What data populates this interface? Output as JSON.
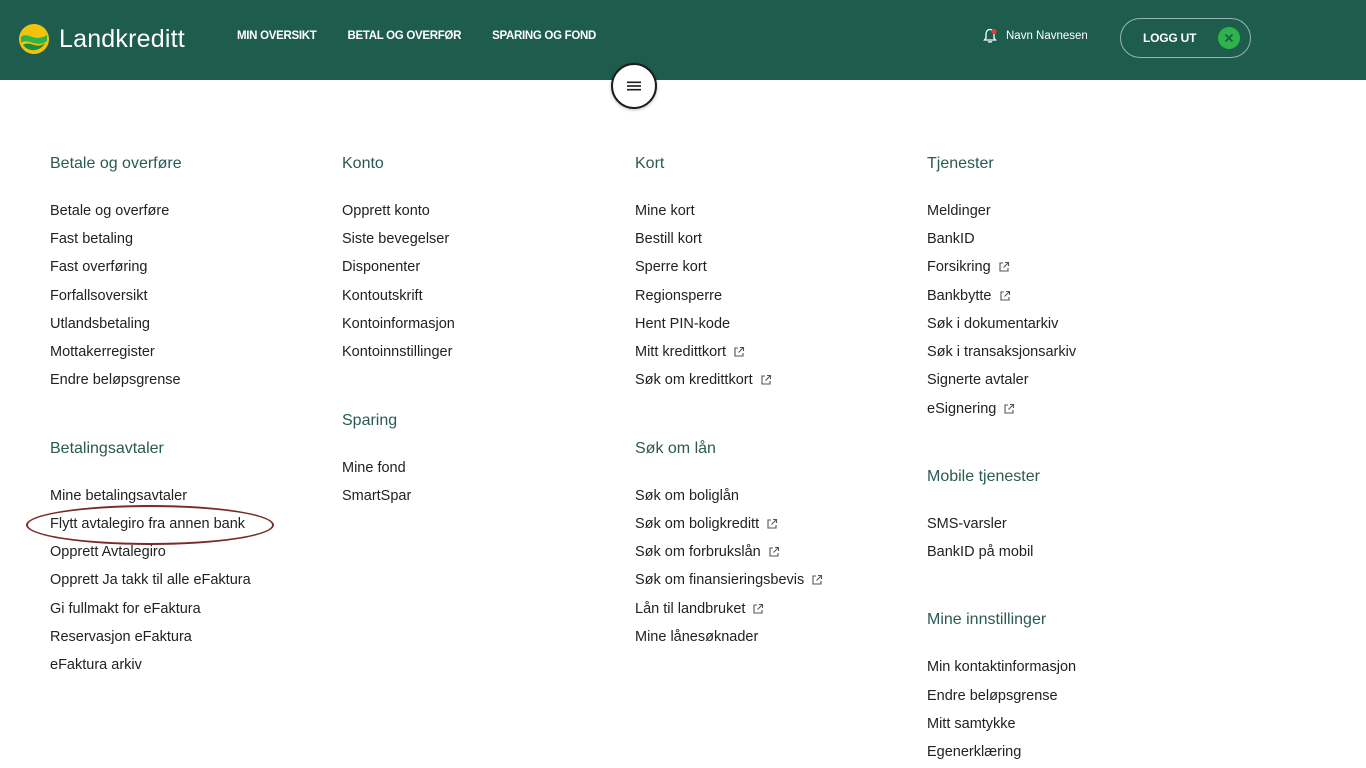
{
  "brand": {
    "name": "Landkreditt"
  },
  "colors": {
    "header_bg": "#1e5c4e",
    "heading": "#2a5a52",
    "accent": "#2fb34a",
    "highlight": "#7a2a2a"
  },
  "nav": [
    "MIN OVERSIKT",
    "BETAL OG OVERFØR",
    "SPARING OG FOND"
  ],
  "user": {
    "name": "Navn Navnesen",
    "icon": "bell-icon"
  },
  "logout": {
    "label": "LOGG UT",
    "icon": "close-icon"
  },
  "menu_toggle": {
    "icon": "hamburger-icon"
  },
  "col1": {
    "h1": "Betale og overføre",
    "s1": [
      "Betale og overføre",
      "Fast betaling",
      "Fast overføring",
      "Forfallsoversikt",
      "Utlandsbetaling",
      "Mottakerregister",
      "Endre beløpsgrense"
    ],
    "h2": "Betalingsavtaler",
    "s2": [
      "Mine betalingsavtaler",
      "Flytt avtalegiro fra annen bank",
      "Opprett Avtalegiro",
      "Opprett Ja takk til alle eFaktura",
      "Gi fullmakt for eFaktura",
      "Reservasjon eFaktura",
      "eFaktura arkiv"
    ]
  },
  "col2": {
    "h1": "Konto",
    "s1": [
      "Opprett konto",
      "Siste bevegelser",
      "Disponenter",
      "Kontoutskrift",
      "Kontoinformasjon",
      "Kontoinnstillinger"
    ],
    "h2": "Sparing",
    "s2": [
      "Mine fond",
      "SmartSpar"
    ]
  },
  "col3": {
    "h1": "Kort",
    "s1": [
      "Mine kort",
      "Bestill kort",
      "Sperre kort",
      "Regionsperre",
      "Hent PIN-kode",
      "Mitt kredittkort",
      "Søk om kredittkort"
    ],
    "h2": "Søk om lån",
    "s2": [
      "Søk om boliglån",
      "Søk om boligkreditt",
      "Søk om forbrukslån",
      "Søk om finansieringsbevis",
      "Lån til landbruket",
      "Mine lånesøknader"
    ]
  },
  "col4": {
    "h1": "Tjenester",
    "s1": [
      "Meldinger",
      "BankID",
      "Forsikring",
      "Bankbytte",
      "Søk i dokumentarkiv",
      "Søk i transaksjonsarkiv",
      "Signerte avtaler",
      "eSignering"
    ],
    "h2": "Mobile tjenester",
    "s2": [
      "SMS-varsler",
      "BankID på mobil"
    ],
    "h3": "Mine innstillinger",
    "s3": [
      "Min kontaktinformasjon",
      "Endre beløpsgrense",
      "Mitt samtykke",
      "Egenerklæring"
    ]
  }
}
